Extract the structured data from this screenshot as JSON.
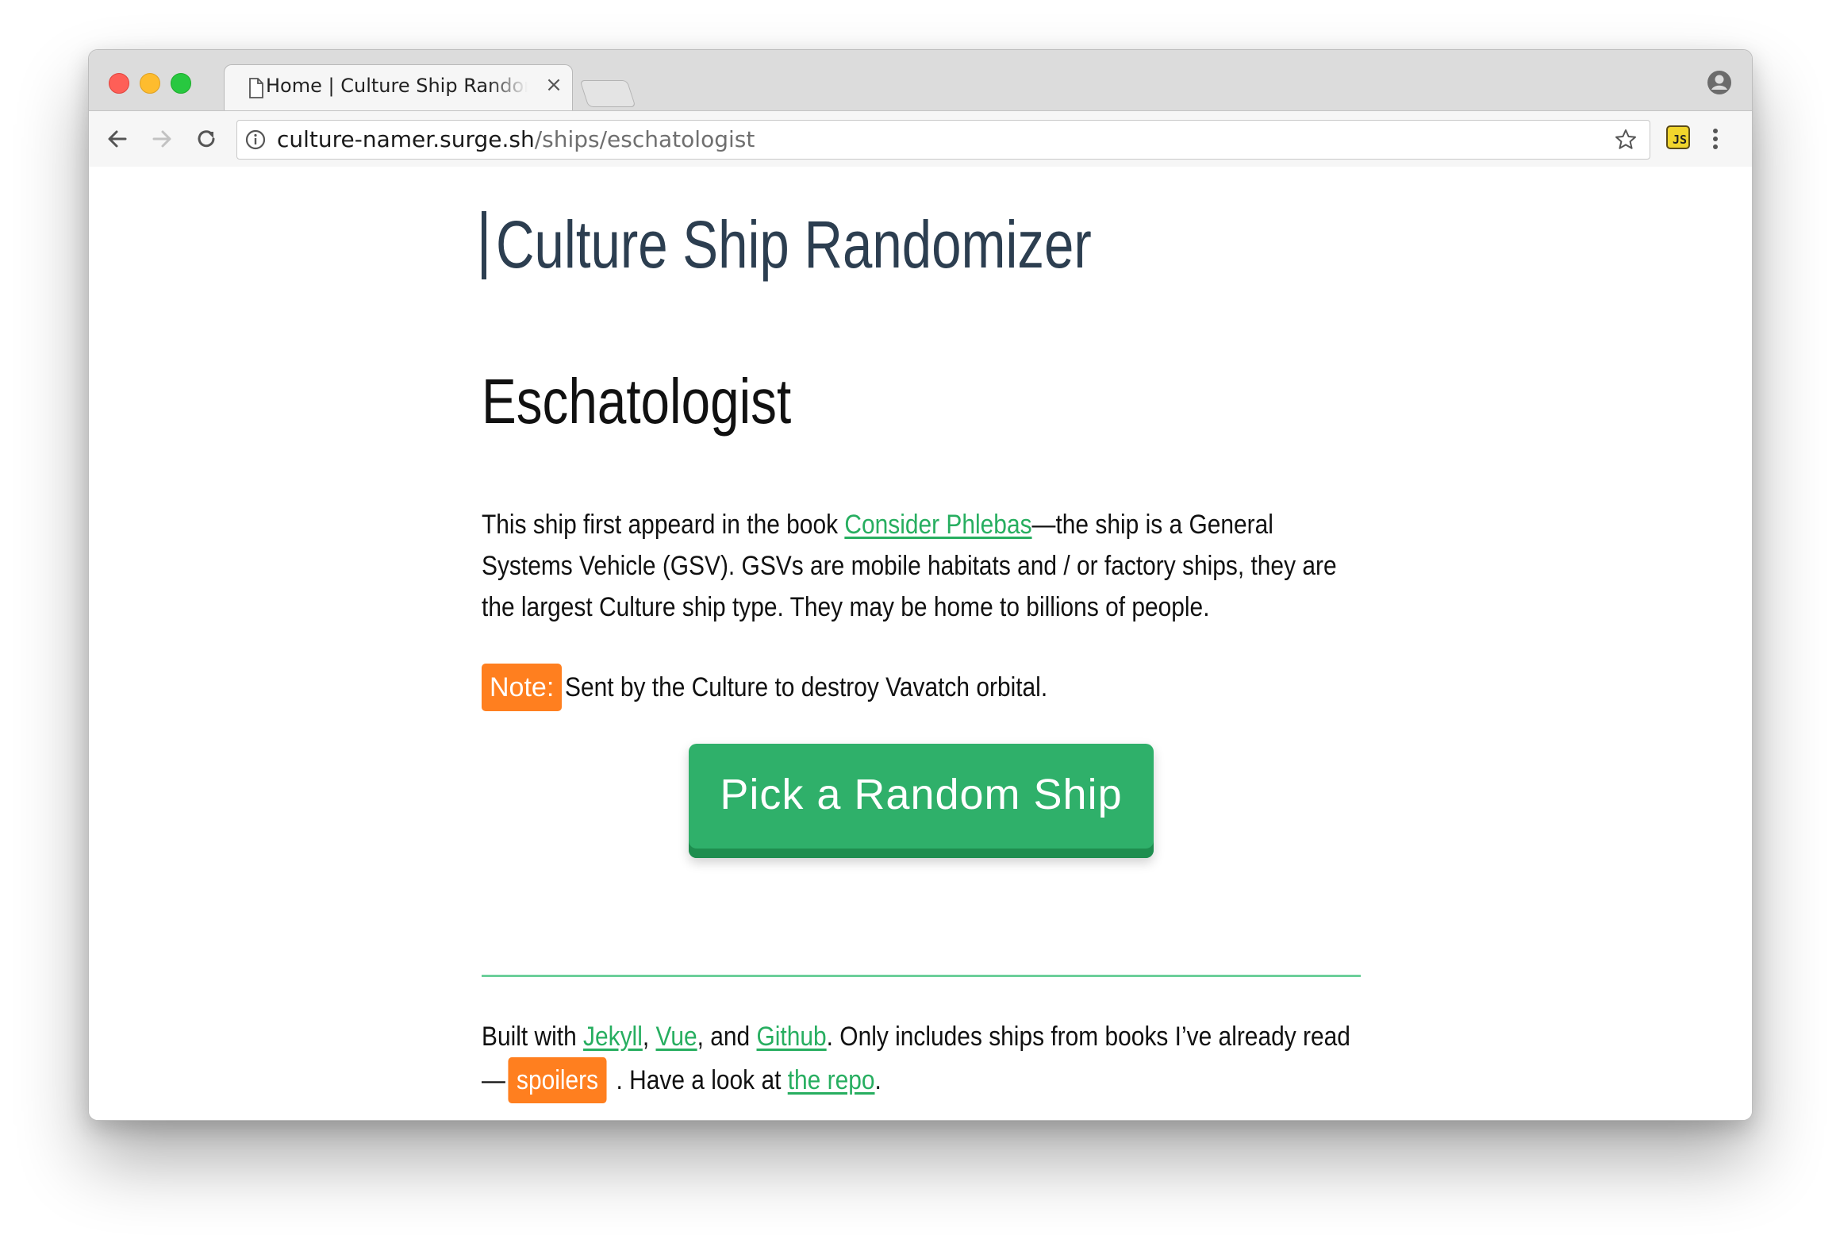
{
  "browser": {
    "tab_title": "Home | Culture Ship Randomizer",
    "tab_close_glyph": "×",
    "url_host": "culture-namer.surge.sh",
    "url_path": "/ships/eschatologist",
    "extension_label": "JS"
  },
  "page": {
    "site_title": "Culture Ship Randomizer",
    "ship_name": "Eschatologist",
    "description": {
      "before_link": "This ship first appeard in the book ",
      "book_link": "Consider Phlebas",
      "after_link": "—the ship is a General Systems Vehicle (GSV). GSVs are mobile habitats and / or factory ships, they are the largest Culture ship type. They may be home to billions of people."
    },
    "note": {
      "badge": "Note:",
      "text": "Sent by the Culture to destroy Vavatch orbital."
    },
    "random_button_label": "Pick a Random Ship",
    "footer": {
      "built_with": "Built with ",
      "jekyll": "Jekyll",
      "sep1": ", ",
      "vue": "Vue",
      "sep2": ", and ",
      "github": "Github",
      "middle": ". Only includes ships from books I’ve already read —",
      "spoilers": "spoilers",
      "look": " . Have a look at ",
      "repo": "the repo",
      "end": "."
    }
  },
  "colors": {
    "title": "#2c3e50",
    "link": "#27ae60",
    "badge": "#ff7f1f",
    "button": "#2fb06a",
    "divider": "#6ccf9a"
  }
}
